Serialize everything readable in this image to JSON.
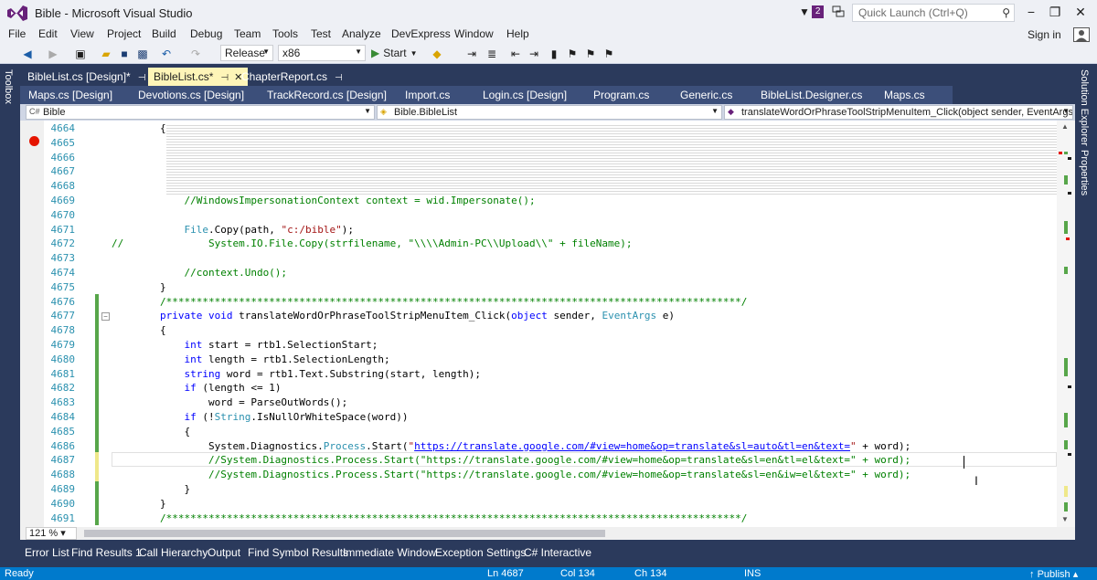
{
  "window": {
    "title": "Bible - Microsoft Visual Studio",
    "notification_count": "2",
    "quick_launch_placeholder": "Quick Launch (Ctrl+Q)",
    "sign_in": "Sign in"
  },
  "menu": [
    "File",
    "Edit",
    "View",
    "Project",
    "Build",
    "Debug",
    "Team",
    "Tools",
    "Test",
    "Analyze",
    "DevExpress",
    "Window",
    "Help"
  ],
  "toolbar": {
    "configuration": "Release",
    "platform": "x86",
    "start_label": "Start"
  },
  "side": {
    "left": "Toolbox",
    "right_top": "Solution Explorer",
    "right_bottom": "Properties"
  },
  "doc_tabs": [
    {
      "label": "BibleList.cs [Design]*",
      "active": false
    },
    {
      "label": "BibleList.cs*",
      "active": true
    },
    {
      "label": "ChapterReport.cs",
      "active": false
    }
  ],
  "doc_tabs2": [
    "Maps.cs [Design]",
    "Devotions.cs [Design]",
    "TrackRecord.cs [Design]",
    "Import.cs",
    "Login.cs [Design]",
    "Program.cs",
    "Generic.cs",
    "BibleList.Designer.cs",
    "Maps.cs"
  ],
  "nav": {
    "project": "Bible",
    "type": "Bible.BibleList",
    "member": "translateWordOrPhraseToolStripMenuItem_Click(object sender, EventArgs e)"
  },
  "code_lines": [
    {
      "n": "4664",
      "html": "        {"
    },
    {
      "n": "4665",
      "html": ""
    },
    {
      "n": "4666",
      "html": ""
    },
    {
      "n": "4667",
      "html": ""
    },
    {
      "n": "4668",
      "html": ""
    },
    {
      "n": "4669",
      "html": "            //WindowsImpersonationContext context = wid.Impersonate();"
    },
    {
      "n": "4670",
      "html": ""
    },
    {
      "n": "4671",
      "html": "            File.Copy(path, \"c:/bible\");"
    },
    {
      "n": "4672",
      "html": "//              System.IO.File.Copy(strfilename, \"\\\\\\\\Admin-PC\\\\Upload\\\\\" + fileName);"
    },
    {
      "n": "4673",
      "html": ""
    },
    {
      "n": "4674",
      "html": "            //context.Undo();"
    },
    {
      "n": "4675",
      "html": "        }"
    },
    {
      "n": "4676",
      "html": "        /***********************************************************************************************/"
    },
    {
      "n": "4677",
      "html": "        private void translateWordOrPhraseToolStripMenuItem_Click(object sender, EventArgs e)"
    },
    {
      "n": "4678",
      "html": "        {"
    },
    {
      "n": "4679",
      "html": "            int start = rtb1.SelectionStart;"
    },
    {
      "n": "4680",
      "html": "            int length = rtb1.SelectionLength;"
    },
    {
      "n": "4681",
      "html": "            string word = rtb1.Text.Substring(start, length);"
    },
    {
      "n": "4682",
      "html": "            if (length <= 1)"
    },
    {
      "n": "4683",
      "html": "                word = ParseOutWords();"
    },
    {
      "n": "4684",
      "html": "            if (!String.IsNullOrWhiteSpace(word))"
    },
    {
      "n": "4685",
      "html": "            {"
    },
    {
      "n": "4686",
      "html": "                System.Diagnostics.Process.Start(\"https://translate.google.com/#view=home&op=translate&sl=auto&tl=en&text=\" + word);"
    },
    {
      "n": "4687",
      "html": "                //System.Diagnostics.Process.Start(\"https://translate.google.com/#view=home&op=translate&sl=en&tl=el&text=\" + word);"
    },
    {
      "n": "4688",
      "html": "                //System.Diagnostics.Process.Start(\"https://translate.google.com/#view=home&op=translate&sl=en&iw=el&text=\" + word);"
    },
    {
      "n": "4689",
      "html": "            }"
    },
    {
      "n": "4690",
      "html": "        }"
    },
    {
      "n": "4691",
      "html": "        /***********************************************************************************************/"
    }
  ],
  "editor": {
    "zoom": "121 %"
  },
  "bottom_tabs": [
    "Error List",
    "Find Results 1",
    "Call Hierarchy",
    "Output",
    "Find Symbol Results",
    "Immediate Window",
    "Exception Settings",
    "C# Interactive"
  ],
  "status": {
    "state": "Ready",
    "ln": "Ln 4687",
    "col": "Col 134",
    "ch": "Ch 134",
    "mode": "INS",
    "publish": "Publish"
  },
  "colors": {
    "chrome": "#eef0f5",
    "frame": "#2b3a5c",
    "active_tab": "#fef5b8",
    "status": "#007acc",
    "breakpoint": "#e51400",
    "saved_change": "#57a64a",
    "unsaved_change": "#efe88a"
  }
}
